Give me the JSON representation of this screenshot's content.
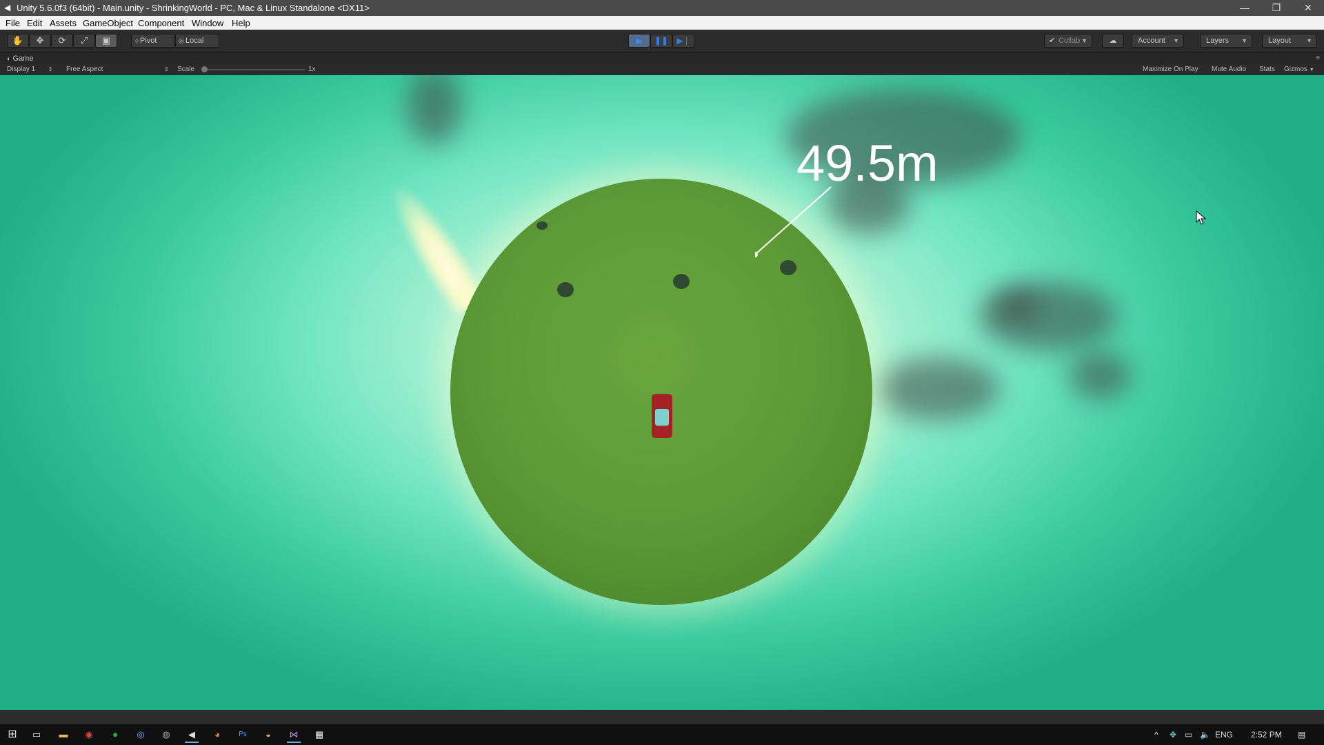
{
  "window": {
    "title": "Unity 5.6.0f3 (64bit) - Main.unity - ShrinkingWorld - PC, Mac & Linux Standalone <DX11>",
    "controls": [
      "minimize-icon",
      "restore-icon",
      "close-icon"
    ]
  },
  "menu": {
    "items": [
      "File",
      "Edit",
      "Assets",
      "GameObject",
      "Component",
      "Window",
      "Help"
    ]
  },
  "toolbar": {
    "tools": [
      "hand-tool-icon",
      "move-tool-icon",
      "rotate-tool-icon",
      "scale-tool-icon",
      "rect-tool-icon"
    ],
    "active_tool": "rect-tool-icon",
    "pivot_label": "Pivot",
    "local_label": "Local",
    "playback": [
      "play-icon",
      "pause-icon",
      "step-icon"
    ],
    "play_active": true,
    "collab_label": "Collab",
    "account_label": "Account",
    "layers_label": "Layers",
    "layout_label": "Layout"
  },
  "game_view": {
    "tab_label": "Game",
    "display_label": "Display 1",
    "aspect_label": "Free Aspect",
    "scale_label": "Scale",
    "scale_value": "1x",
    "maximize_label": "Maximize On Play",
    "mute_label": "Mute Audio",
    "stats_label": "Stats",
    "gizmos_label": "Gizmos"
  },
  "scene": {
    "distance_readout": "49.5m",
    "sky_color": "#2fbf93",
    "planet_color": "#5f9c37",
    "car_color": "#a22225"
  },
  "taskbar": {
    "apps": [
      "windows-start-icon",
      "task-view-icon",
      "file-explorer-icon",
      "chrome-icon",
      "spotify-icon",
      "app-icon",
      "steam-icon",
      "unity-icon",
      "blender-icon",
      "photoshop-icon",
      "app-icon",
      "visual-studio-icon",
      "calculator-icon"
    ],
    "tray": {
      "language": "ENG",
      "time": "2:52 PM"
    }
  }
}
